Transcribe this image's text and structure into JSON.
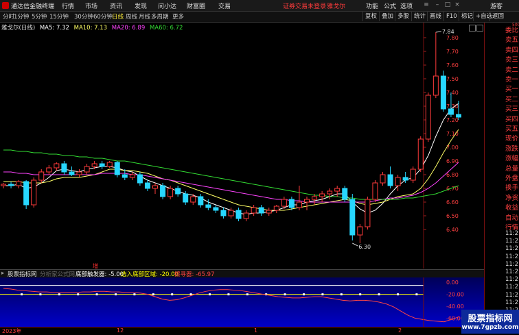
{
  "titlebar": {
    "app_name": "通达信金融终端",
    "menus": [
      "行情",
      "市场",
      "资讯",
      "发现",
      "问小达",
      "财富圈",
      "交易"
    ],
    "notice": "证券交易未登录",
    "stock_name": "雅戈尔",
    "right_menus": [
      "功能",
      "公式",
      "选项"
    ],
    "guest": "游客",
    "colors": {
      "notice": "#ff3b3b"
    }
  },
  "toolbar": {
    "timeframes": [
      "分时",
      "1分钟",
      "5分钟",
      "15分钟",
      "30分钟",
      "60分钟",
      "日线",
      "周线",
      "月线",
      "多周期",
      "更多"
    ],
    "active_timeframe": "日线",
    "right_buttons": [
      "复权",
      "叠加",
      "多股",
      "统计",
      "画线",
      "F10",
      "标记",
      "+自选",
      "返回"
    ]
  },
  "infoline": {
    "title": "雅戈尔(日线)",
    "ma5": "MA5: 7.32",
    "ma10": "MA10: 7.13",
    "ma20": "MA20: 6.89",
    "ma60": "MA60: 6.72",
    "colors": {
      "ma5": "#ffffff",
      "ma10": "#ffff66",
      "ma20": "#ff44ff",
      "ma60": "#33dd33"
    }
  },
  "indicator": {
    "name": "股票指标网",
    "formula": "分析家公式网",
    "s1_label": "底部触发器: -5.00",
    "s2_label": "选入底部区域: -20.00",
    "s3_label": "擦寻器: -65.97",
    "marker": "增",
    "y_labels": [
      "0.00",
      "-20.00",
      "-40.00",
      "-60.00"
    ],
    "colors": {
      "s1": "#ffffff",
      "s2": "#ffff00",
      "s3": "#ff4444"
    }
  },
  "date_labels": [
    "2023年",
    "12",
    "1",
    "2"
  ],
  "right_panel": {
    "scale_top": "500",
    "labels": [
      "委比",
      "卖五",
      "卖四",
      "卖三",
      "卖二",
      "卖一",
      "买一",
      "买二",
      "买三",
      "买四",
      "买五",
      "现价",
      "涨跌",
      "涨幅",
      "总量",
      "外盘",
      "换手",
      "净资",
      "收益",
      "自动",
      "行情"
    ],
    "times": [
      "11:2",
      "11:2",
      "11:2",
      "11:2",
      "11:2",
      "11:2",
      "11:2",
      "11:2",
      "11:2",
      "11:2",
      "11:2",
      "11:2",
      "11:2"
    ]
  },
  "watermark": {
    "line1": "股票指标网",
    "line2": "www.7gpzb.com"
  },
  "chart_data": {
    "type": "candlestick",
    "y_axis_labels": [
      "7.80",
      "7.70",
      "7.60",
      "7.50",
      "7.40",
      "7.30",
      "7.20",
      "7.10",
      "7.00",
      "6.90",
      "6.80",
      "6.70",
      "6.60",
      "6.50",
      "6.40"
    ],
    "ylim": [
      6.35,
      7.9
    ],
    "annotations": [
      {
        "text": "7.84",
        "value": 7.84
      },
      {
        "text": "6.30",
        "value": 6.3
      }
    ],
    "candles": [
      [
        6.72,
        6.74,
        6.7,
        6.73
      ],
      [
        6.73,
        6.75,
        6.7,
        6.72
      ],
      [
        6.72,
        6.76,
        6.7,
        6.75
      ],
      [
        6.75,
        6.76,
        6.55,
        6.58
      ],
      [
        6.58,
        6.78,
        6.56,
        6.76
      ],
      [
        6.76,
        6.84,
        6.74,
        6.82
      ],
      [
        6.82,
        6.87,
        6.8,
        6.85
      ],
      [
        6.85,
        6.89,
        6.83,
        6.88
      ],
      [
        6.88,
        6.9,
        6.8,
        6.82
      ],
      [
        6.82,
        6.86,
        6.79,
        6.8
      ],
      [
        6.8,
        6.84,
        6.78,
        6.82
      ],
      [
        6.82,
        6.88,
        6.8,
        6.86
      ],
      [
        6.86,
        6.9,
        6.84,
        6.88
      ],
      [
        6.88,
        6.9,
        6.84,
        6.86
      ],
      [
        6.86,
        6.9,
        6.85,
        6.89
      ],
      [
        6.89,
        6.9,
        6.78,
        6.8
      ],
      [
        6.8,
        6.84,
        6.76,
        6.78
      ],
      [
        6.78,
        6.82,
        6.76,
        6.8
      ],
      [
        6.8,
        6.82,
        6.72,
        6.74
      ],
      [
        6.74,
        6.76,
        6.68,
        6.7
      ],
      [
        6.7,
        6.74,
        6.66,
        6.72
      ],
      [
        6.72,
        6.74,
        6.62,
        6.64
      ],
      [
        6.64,
        6.72,
        6.62,
        6.7
      ],
      [
        6.7,
        6.72,
        6.64,
        6.66
      ],
      [
        6.66,
        6.68,
        6.58,
        6.6
      ],
      [
        6.6,
        6.66,
        6.58,
        6.64
      ],
      [
        6.64,
        6.66,
        6.56,
        6.58
      ],
      [
        6.58,
        6.62,
        6.54,
        6.56
      ],
      [
        6.56,
        6.58,
        6.52,
        6.54
      ],
      [
        6.54,
        6.56,
        6.48,
        6.5
      ],
      [
        6.5,
        6.56,
        6.48,
        6.54
      ],
      [
        6.54,
        6.56,
        6.46,
        6.48
      ],
      [
        6.48,
        6.54,
        6.46,
        6.52
      ],
      [
        6.52,
        6.58,
        6.5,
        6.56
      ],
      [
        6.56,
        6.58,
        6.5,
        6.52
      ],
      [
        6.52,
        6.56,
        6.5,
        6.54
      ],
      [
        6.54,
        6.58,
        6.52,
        6.57
      ],
      [
        6.57,
        6.64,
        6.55,
        6.62
      ],
      [
        6.62,
        6.64,
        6.54,
        6.56
      ],
      [
        6.56,
        6.72,
        6.54,
        6.6
      ],
      [
        6.6,
        6.64,
        6.54,
        6.62
      ],
      [
        6.62,
        6.66,
        6.58,
        6.64
      ],
      [
        6.64,
        6.68,
        6.6,
        6.66
      ],
      [
        6.66,
        6.7,
        6.62,
        6.68
      ],
      [
        6.68,
        6.72,
        6.64,
        6.7
      ],
      [
        6.7,
        6.72,
        6.6,
        6.62
      ],
      [
        6.62,
        6.66,
        6.32,
        6.36
      ],
      [
        6.36,
        6.44,
        6.3,
        6.42
      ],
      [
        6.42,
        6.64,
        6.4,
        6.62
      ],
      [
        6.62,
        6.76,
        6.6,
        6.74
      ],
      [
        6.74,
        6.82,
        6.72,
        6.8
      ],
      [
        6.8,
        6.86,
        6.7,
        6.72
      ],
      [
        6.72,
        6.8,
        6.68,
        6.78
      ],
      [
        6.78,
        6.82,
        6.74,
        6.76
      ],
      [
        6.76,
        6.86,
        6.74,
        6.84
      ],
      [
        6.84,
        7.08,
        6.82,
        7.06
      ],
      [
        7.06,
        7.4,
        7.04,
        7.38
      ],
      [
        7.38,
        7.84,
        7.36,
        7.52
      ],
      [
        7.52,
        7.56,
        7.26,
        7.28
      ],
      [
        7.28,
        7.4,
        7.22,
        7.24
      ],
      [
        7.24,
        7.34,
        7.2,
        7.22
      ]
    ],
    "moving_averages": {
      "MA5": [
        6.72,
        6.72,
        6.73,
        6.7,
        6.71,
        6.74,
        6.78,
        6.83,
        6.84,
        6.83,
        6.82,
        6.84,
        6.85,
        6.86,
        6.86,
        6.85,
        6.83,
        6.82,
        6.79,
        6.76,
        6.74,
        6.72,
        6.7,
        6.68,
        6.66,
        6.65,
        6.63,
        6.6,
        6.58,
        6.56,
        6.54,
        6.52,
        6.51,
        6.52,
        6.52,
        6.53,
        6.54,
        6.56,
        6.58,
        6.58,
        6.6,
        6.61,
        6.62,
        6.64,
        6.66,
        6.66,
        6.6,
        6.55,
        6.52,
        6.54,
        6.59,
        6.66,
        6.72,
        6.76,
        6.78,
        6.84,
        6.94,
        7.08,
        7.2,
        7.28,
        7.32
      ],
      "MA10": [
        6.75,
        6.75,
        6.75,
        6.74,
        6.74,
        6.74,
        6.75,
        6.77,
        6.78,
        6.78,
        6.78,
        6.79,
        6.8,
        6.82,
        6.84,
        6.84,
        6.83,
        6.83,
        6.82,
        6.81,
        6.79,
        6.77,
        6.76,
        6.74,
        6.72,
        6.7,
        6.68,
        6.66,
        6.64,
        6.62,
        6.6,
        6.58,
        6.57,
        6.56,
        6.55,
        6.54,
        6.54,
        6.54,
        6.55,
        6.56,
        6.57,
        6.58,
        6.59,
        6.6,
        6.61,
        6.62,
        6.61,
        6.59,
        6.58,
        6.59,
        6.6,
        6.62,
        6.64,
        6.65,
        6.66,
        6.7,
        6.77,
        6.86,
        6.96,
        7.05,
        7.13
      ],
      "MA20": [
        6.82,
        6.82,
        6.81,
        6.81,
        6.8,
        6.8,
        6.8,
        6.8,
        6.8,
        6.8,
        6.8,
        6.8,
        6.8,
        6.81,
        6.81,
        6.81,
        6.81,
        6.8,
        6.8,
        6.79,
        6.78,
        6.77,
        6.76,
        6.75,
        6.74,
        6.73,
        6.72,
        6.71,
        6.7,
        6.69,
        6.68,
        6.67,
        6.66,
        6.65,
        6.64,
        6.63,
        6.62,
        6.62,
        6.61,
        6.61,
        6.6,
        6.6,
        6.6,
        6.6,
        6.6,
        6.6,
        6.6,
        6.6,
        6.6,
        6.61,
        6.62,
        6.63,
        6.63,
        6.64,
        6.65,
        6.67,
        6.7,
        6.74,
        6.79,
        6.84,
        6.89
      ],
      "MA60": [
        6.98,
        6.98,
        6.97,
        6.97,
        6.96,
        6.96,
        6.95,
        6.95,
        6.94,
        6.94,
        6.93,
        6.93,
        6.92,
        6.92,
        6.91,
        6.9,
        6.9,
        6.89,
        6.88,
        6.87,
        6.86,
        6.85,
        6.84,
        6.83,
        6.82,
        6.81,
        6.8,
        6.79,
        6.78,
        6.77,
        6.76,
        6.75,
        6.74,
        6.73,
        6.72,
        6.71,
        6.7,
        6.69,
        6.68,
        6.67,
        6.66,
        6.65,
        6.65,
        6.64,
        6.64,
        6.63,
        6.63,
        6.62,
        6.62,
        6.62,
        6.62,
        6.62,
        6.62,
        6.63,
        6.63,
        6.64,
        6.65,
        6.66,
        6.68,
        6.7,
        6.72
      ]
    },
    "indicator_series": {
      "s1": -5.0,
      "s2": -20.0,
      "s3": [
        -10,
        -11,
        -13,
        -14,
        -15,
        -16,
        -16,
        -17,
        -17,
        -17,
        -17,
        -16,
        -16,
        -15,
        -15,
        -16,
        -16,
        -17,
        -17,
        -18,
        -20,
        -24,
        -28,
        -30,
        -29,
        -26,
        -22,
        -18,
        -15,
        -13,
        -12,
        -12,
        -13,
        -14,
        -16,
        -18,
        -20,
        -22,
        -24,
        -25,
        -26,
        -26,
        -25,
        -24,
        -24,
        -26,
        -28,
        -30,
        -31,
        -30,
        -30,
        -31,
        -33,
        -36,
        -41,
        -48,
        -55,
        -60,
        -62,
        -64,
        -65,
        -66,
        -62,
        -58
      ],
      "ylim": [
        -72,
        6
      ]
    }
  }
}
